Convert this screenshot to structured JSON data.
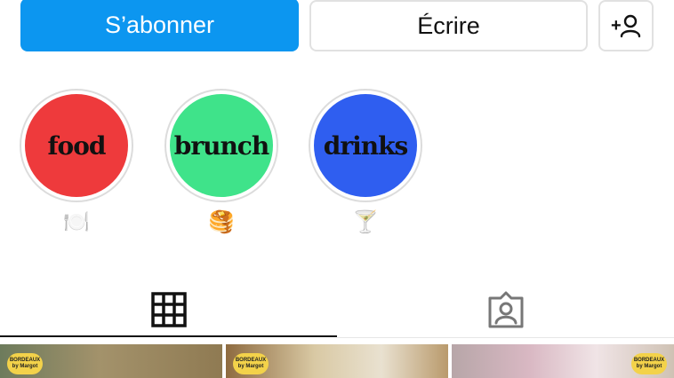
{
  "actions": {
    "subscribe_label": "S’abonner",
    "write_label": "Écrire",
    "add_user_icon": "add-user-icon"
  },
  "highlights": [
    {
      "label": "food",
      "emoji": "🍽️",
      "color": "#ee3a3c"
    },
    {
      "label": "brunch",
      "emoji": "🥞",
      "color": "#3fe38a"
    },
    {
      "label": "drinks",
      "emoji": "🍸",
      "color": "#2f5ef0"
    }
  ],
  "tabs": {
    "grid_icon": "grid-icon",
    "tagged_icon": "tagged-user-icon"
  },
  "posts": [
    {
      "badge": "BORDEAUX by Margot",
      "colors": [
        "#6d7b5c",
        "#8f7a52"
      ]
    },
    {
      "badge": "BORDEAUX by Margot",
      "colors": [
        "#d9c9a4",
        "#8e6b40"
      ]
    },
    {
      "badge": "BORDEAUX by Margot",
      "colors": [
        "#d9b8c3",
        "#b7a6a8"
      ]
    }
  ],
  "colors": {
    "accent": "#0c96f0"
  }
}
